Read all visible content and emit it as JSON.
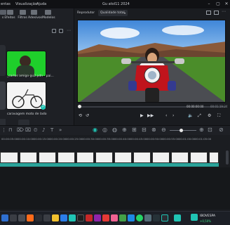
{
  "titlebar": {
    "menu": [
      "entas",
      "Visualização",
      "Ajuda"
    ],
    "title": "Gu atol11 2024"
  },
  "left_tabs": [
    "s",
    "Efeitos",
    "Filtros",
    "Adesivos",
    "Modelos"
  ],
  "media": [
    {
      "caption": "_carlos amigo gu2.pdn - pai..."
    },
    {
      "caption": "caravagem moto de lado"
    }
  ],
  "player": {
    "tab_label": "Reprodutor",
    "quality": "Qualidade total",
    "time_current": "00:00:00:00",
    "time_total": "00:01:19:24"
  },
  "ruler": {
    "ticks": [
      "00:00:05:00",
      "00:00:10:00",
      "00:00:15:00",
      "00:00:20:00",
      "00:00:25:00",
      "00:00:30:00",
      "00:00:35:00",
      "00:00:40:00",
      "00:00:45:00",
      "00:00:50:00",
      "00:00:55:00",
      "00:01:00:00",
      "00:01:05:00"
    ]
  },
  "taskbar": {
    "stock_label": "IBOVESPA",
    "stock_value": "+0,50%"
  }
}
